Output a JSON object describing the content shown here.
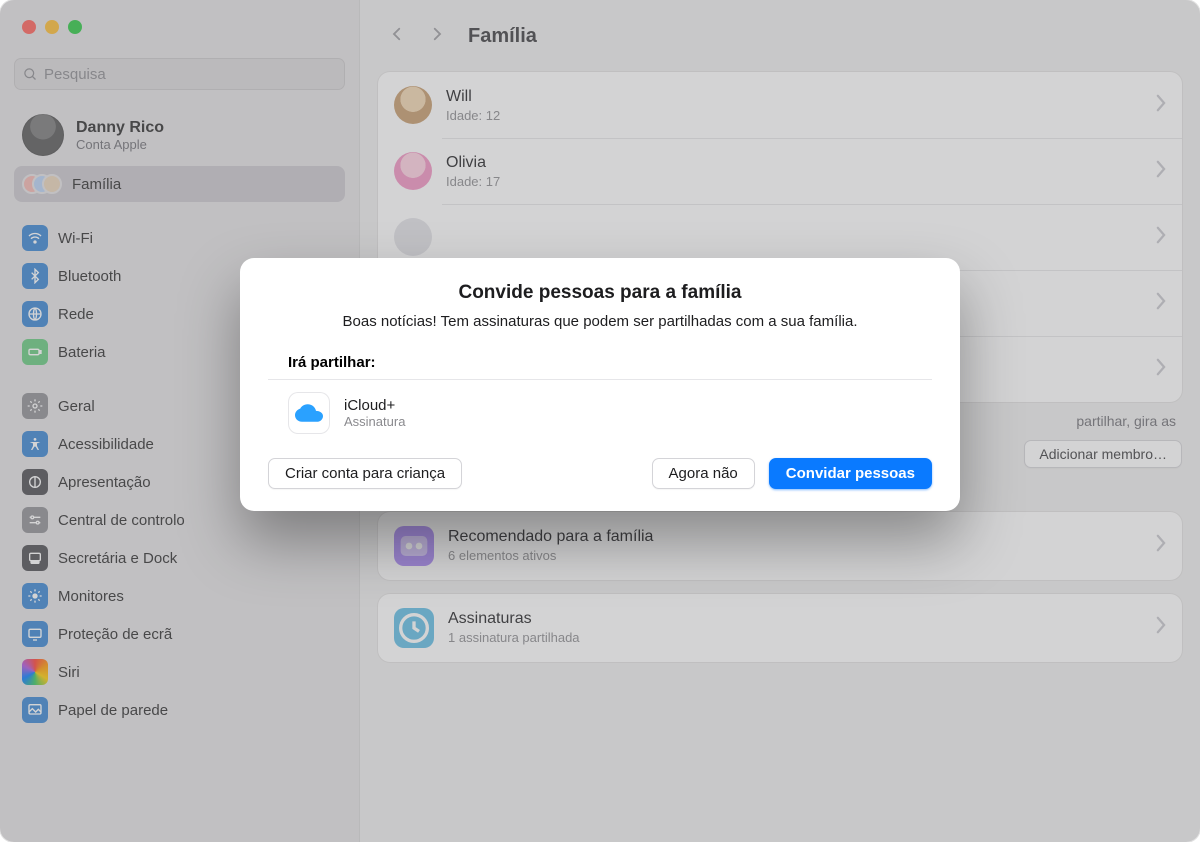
{
  "search": {
    "placeholder": "Pesquisa"
  },
  "account": {
    "name": "Danny Rico",
    "subtitle": "Conta Apple"
  },
  "sidebar": {
    "familia": "Família",
    "items": [
      "Wi-Fi",
      "Bluetooth",
      "Rede",
      "Bateria",
      "Geral",
      "Acessibilidade",
      "Apresentação",
      "Central de controlo",
      "Secretária e Dock",
      "Monitores",
      "Proteção de ecrã",
      "Siri",
      "Papel de parede"
    ]
  },
  "page": {
    "title": "Família"
  },
  "members": [
    {
      "name": "Will",
      "sub": "Idade: 12",
      "avatar": "#e0c498"
    },
    {
      "name": "Olivia",
      "sub": "Idade: 17",
      "avatar": "#f2a0c9"
    },
    {
      "name": "",
      "sub": "",
      "avatar": "#cfcfd4"
    },
    {
      "name": "",
      "sub": "",
      "avatar": "#cfcfd4"
    },
    {
      "name": "",
      "sub": "",
      "avatar": "#cfcfd4"
    }
  ],
  "hint_tail": "partilhar, gira as",
  "add_member_btn": "Adicionar membro…",
  "sections": {
    "recommended": {
      "title": "Recomendado para a família",
      "sub": "6 elementos ativos"
    },
    "subs": {
      "title": "Assinaturas",
      "sub": "1 assinatura partilhada"
    }
  },
  "dialog": {
    "title": "Convide pessoas para a família",
    "message": "Boas notícias! Tem assinaturas que podem ser partilhadas com a sua família.",
    "share_label": "Irá partilhar:",
    "share_item": {
      "name": "iCloud+",
      "sub": "Assinatura"
    },
    "btn_child": "Criar conta para criança",
    "btn_later": "Agora não",
    "btn_invite": "Convidar pessoas"
  }
}
